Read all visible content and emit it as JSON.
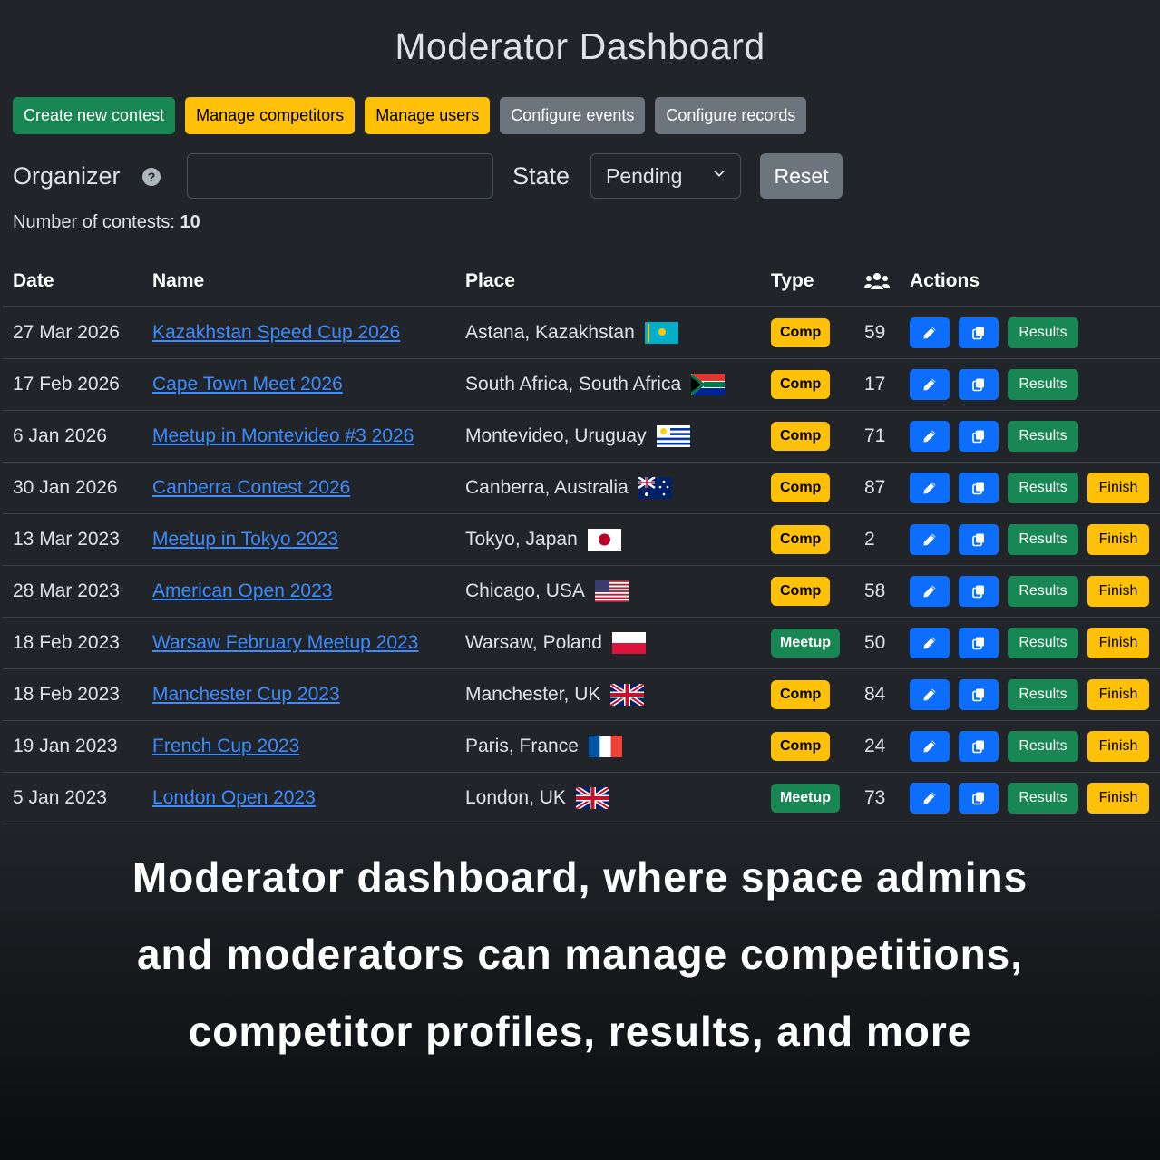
{
  "header": {
    "title": "Moderator Dashboard"
  },
  "toolbar": {
    "create_contest": "Create new contest",
    "manage_competitors": "Manage competitors",
    "manage_users": "Manage users",
    "configure_events": "Configure events",
    "configure_records": "Configure records"
  },
  "filters": {
    "organizer_label": "Organizer",
    "organizer_help_icon": "?",
    "organizer_value": "",
    "state_label": "State",
    "state_value": "Pending",
    "reset_label": "Reset"
  },
  "summary": {
    "label": "Number of contests:",
    "count": "10"
  },
  "table": {
    "headers": {
      "date": "Date",
      "name": "Name",
      "place": "Place",
      "type": "Type",
      "participants_icon": "users-icon",
      "actions": "Actions"
    },
    "action_labels": {
      "results": "Results",
      "finish": "Finish"
    },
    "rows": [
      {
        "date": "27 Mar 2026",
        "name": "Kazakhstan Speed Cup 2026",
        "place": "Astana, Kazakhstan",
        "flag": "kz",
        "type": "Comp",
        "participants": "59",
        "finish": false
      },
      {
        "date": "17 Feb 2026",
        "name": "Cape Town Meet 2026",
        "place": "South Africa, South Africa",
        "flag": "za",
        "type": "Comp",
        "participants": "17",
        "finish": false
      },
      {
        "date": "6 Jan 2026",
        "name": "Meetup in Montevideo #3 2026",
        "place": "Montevideo, Uruguay",
        "flag": "uy",
        "type": "Comp",
        "participants": "71",
        "finish": false
      },
      {
        "date": "30 Jan 2026",
        "name": "Canberra Contest 2026",
        "place": "Canberra, Australia",
        "flag": "au",
        "type": "Comp",
        "participants": "87",
        "finish": true
      },
      {
        "date": "13 Mar 2023",
        "name": "Meetup in Tokyo 2023",
        "place": "Tokyo, Japan",
        "flag": "jp",
        "type": "Comp",
        "participants": "2",
        "finish": true
      },
      {
        "date": "28 Mar 2023",
        "name": "American Open 2023",
        "place": "Chicago, USA",
        "flag": "us",
        "type": "Comp",
        "participants": "58",
        "finish": true
      },
      {
        "date": "18 Feb 2023",
        "name": "Warsaw February Meetup 2023",
        "place": "Warsaw, Poland",
        "flag": "pl",
        "type": "Meetup",
        "participants": "50",
        "finish": true
      },
      {
        "date": "18 Feb 2023",
        "name": "Manchester Cup 2023",
        "place": "Manchester, UK",
        "flag": "gb",
        "type": "Comp",
        "participants": "84",
        "finish": true
      },
      {
        "date": "19 Jan 2023",
        "name": "French Cup 2023",
        "place": "Paris, France",
        "flag": "fr",
        "type": "Comp",
        "participants": "24",
        "finish": true
      },
      {
        "date": "5 Jan 2023",
        "name": "London Open 2023",
        "place": "London, UK",
        "flag": "gb",
        "type": "Meetup",
        "participants": "73",
        "finish": true
      }
    ]
  },
  "caption": {
    "line1": "Moderator dashboard, where space admins",
    "line2": "and moderators can manage competitions,",
    "line3": "competitor profiles, results, and more"
  },
  "colors": {
    "background": "#212529",
    "link": "#3d8bfd",
    "success": "#198754",
    "warning": "#ffc107",
    "secondary": "#6c757d",
    "primary": "#0d6efd"
  }
}
